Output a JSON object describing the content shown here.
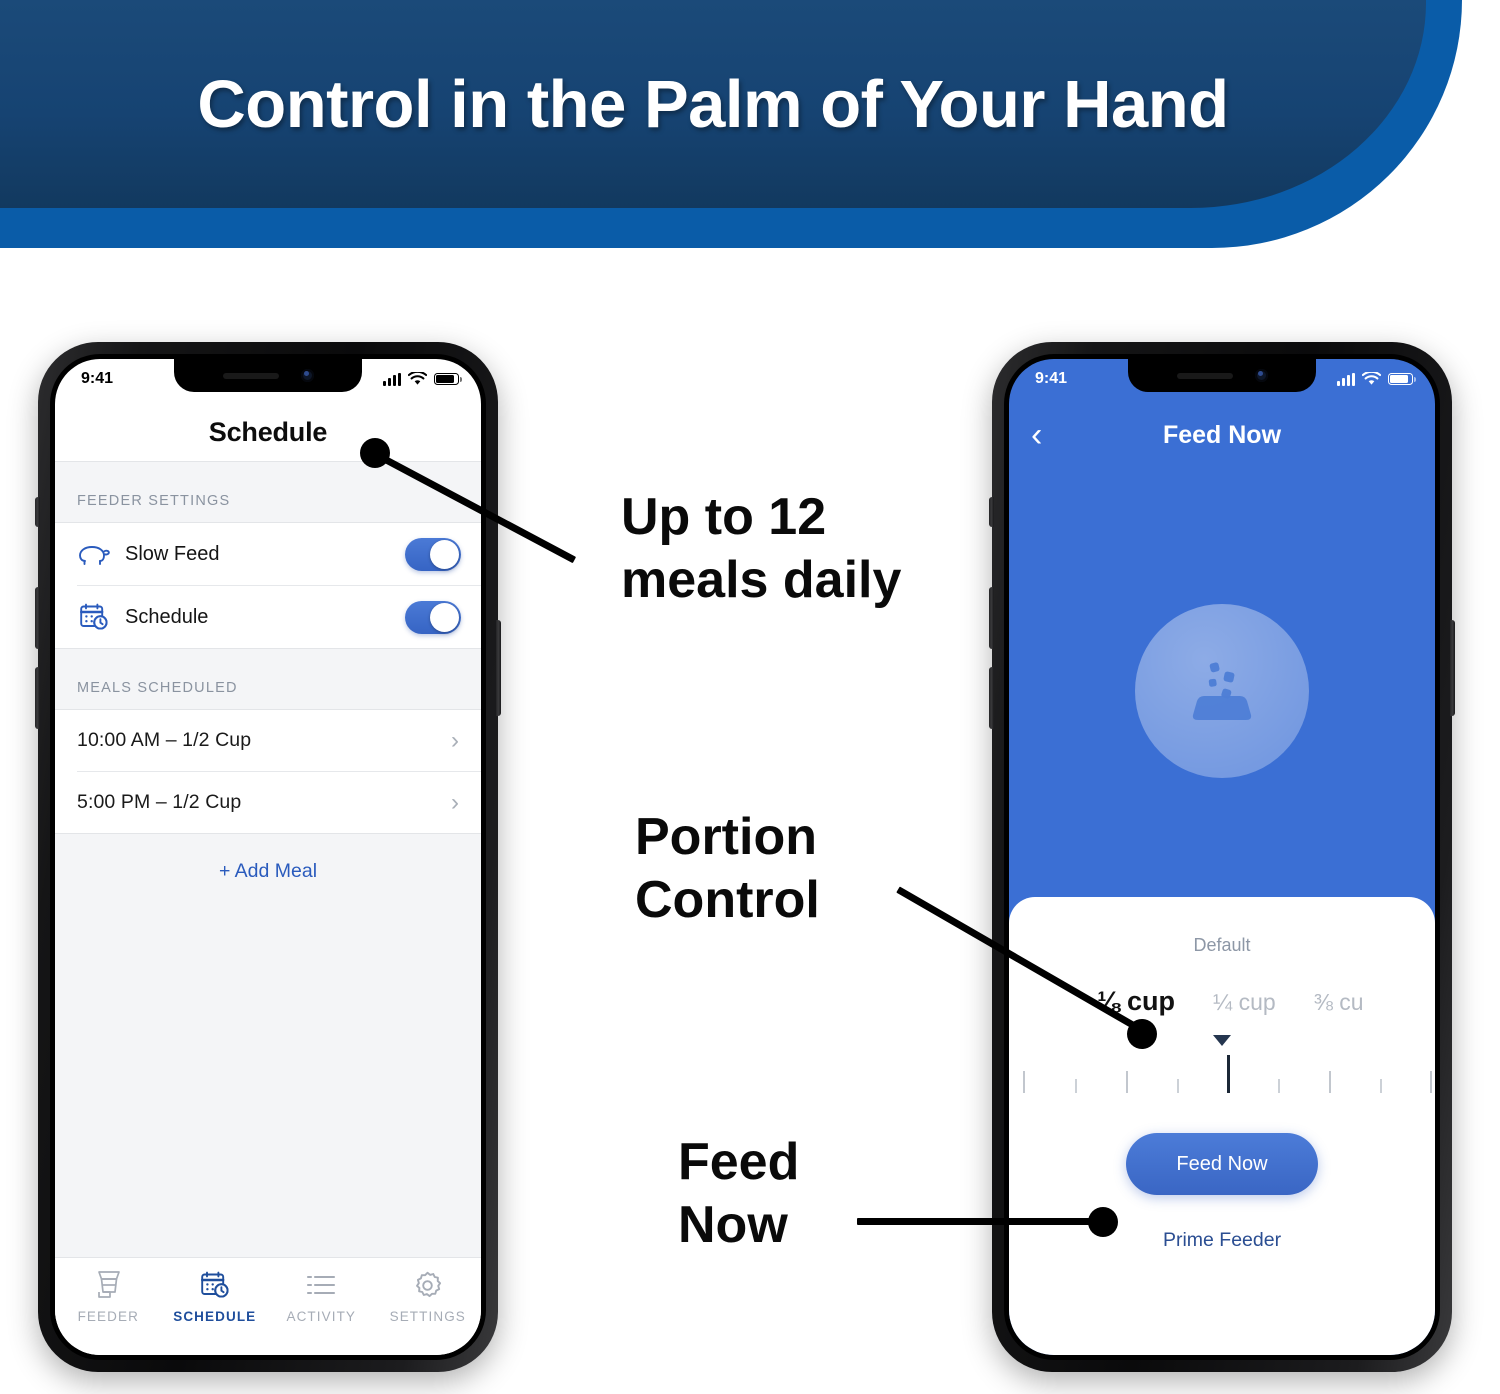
{
  "banner": {
    "title": "Control in the Palm of Your Hand",
    "dark_color": "#164372",
    "light_color": "#0a5ca8"
  },
  "callouts": [
    {
      "id": "meals",
      "line1": "Up to 12",
      "line2": "meals daily"
    },
    {
      "id": "portion",
      "line1": "Portion",
      "line2": "Control"
    },
    {
      "id": "feed",
      "line1": "Feed",
      "line2": "Now"
    }
  ],
  "left_phone": {
    "status": {
      "time": "9:41",
      "signal": "signal-bars-icon",
      "wifi": "wifi-icon",
      "battery": "battery-icon"
    },
    "nav_title": "Schedule",
    "sections": [
      {
        "header": "FEEDER SETTINGS",
        "rows": [
          {
            "icon": "turtle-icon",
            "label": "Slow Feed",
            "toggle": "on"
          },
          {
            "icon": "calendar-clock-icon",
            "label": "Schedule",
            "toggle": "on"
          }
        ]
      },
      {
        "header": "MEALS SCHEDULED",
        "meals": [
          {
            "text": "10:00 AM  –  1/2 Cup",
            "chevron": "chevron-right-icon"
          },
          {
            "text": "5:00 PM  –  1/2 Cup",
            "chevron": "chevron-right-icon"
          }
        ],
        "add_label": "+ Add Meal"
      }
    ],
    "tabs": [
      {
        "icon": "feeder-hopper-icon",
        "label": "FEEDER",
        "active": false
      },
      {
        "icon": "calendar-clock-icon",
        "label": "SCHEDULE",
        "active": true
      },
      {
        "icon": "activity-list-icon",
        "label": "ACTIVITY",
        "active": false
      },
      {
        "icon": "gear-icon",
        "label": "SETTINGS",
        "active": false
      }
    ],
    "accent_color": "#2a5bbd",
    "toggle_color": "#3d69c6"
  },
  "right_phone": {
    "status": {
      "time": "9:41",
      "signal": "signal-bars-icon",
      "wifi": "wifi-icon",
      "battery": "battery-icon"
    },
    "back": "chevron-left-icon",
    "nav_title": "Feed Now",
    "hero_icon": "food-bowl-kibble-icon",
    "sheet": {
      "default_label": "Default",
      "portions": [
        {
          "label": "⅛ cup",
          "selected": true
        },
        {
          "label": "¼ cup",
          "selected": false
        },
        {
          "label": "⅜ cu",
          "selected": false
        }
      ],
      "marker": "down-triangle-marker",
      "ruler_ticks": 11,
      "feed_button": "Feed Now",
      "prime_link": "Prime Feeder"
    },
    "screen_color": "#3b6fd4",
    "button_color": "#3f6ec9"
  }
}
